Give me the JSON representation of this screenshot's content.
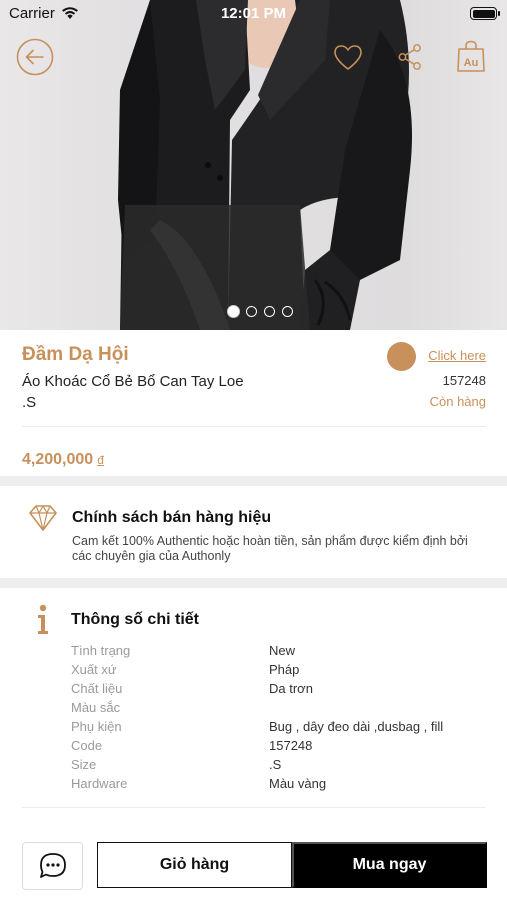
{
  "status_bar": {
    "carrier": "Carrier",
    "time": "12:01 PM"
  },
  "icons": {
    "back": "arrow-left-icon",
    "favorite": "heart-icon",
    "share": "share-icon",
    "bag": "shopping-bag-au-icon",
    "bag_label": "Au",
    "policy": "diamond-icon",
    "specs": "info-icon",
    "chat": "chat-bubble-icon"
  },
  "gallery": {
    "page_count": 4,
    "active_index": 0
  },
  "product": {
    "name": "Đầm Dạ Hội",
    "subtitle_line1": "Áo Khoác Cổ Bẻ Bổ Can Tay Loe",
    "subtitle_line2": ".S",
    "color_link": "Click here",
    "sku": "157248",
    "stock": "Còn hàng",
    "price": "4,200,000",
    "currency": "đ"
  },
  "policy": {
    "title": "Chính sách bán hàng hiệu",
    "text": "Cam kết 100% Authentic hoặc hoàn tiền, sản phẩm được kiểm định bởi các chuyên gia của Authonly"
  },
  "specs": {
    "title": "Thông số chi tiết",
    "rows": [
      {
        "label": "Tình trạng",
        "value": "New"
      },
      {
        "label": "Xuất xứ",
        "value": "Pháp"
      },
      {
        "label": "Chất liệu",
        "value": "Da trơn"
      },
      {
        "label": "Màu sắc",
        "value": ""
      },
      {
        "label": "Phụ kiện",
        "value": "Bug , dây đeo dài ,dusbag , fill"
      },
      {
        "label": "Code",
        "value": "157248"
      },
      {
        "label": "Size",
        "value": ".S"
      },
      {
        "label": "Hardware",
        "value": "Màu vàng"
      }
    ]
  },
  "actions": {
    "cart": "Giỏ hàng",
    "buy": "Mua ngay"
  },
  "colors": {
    "accent": "#c8905a",
    "primary": "#000000",
    "separator": "#eeeeee"
  }
}
